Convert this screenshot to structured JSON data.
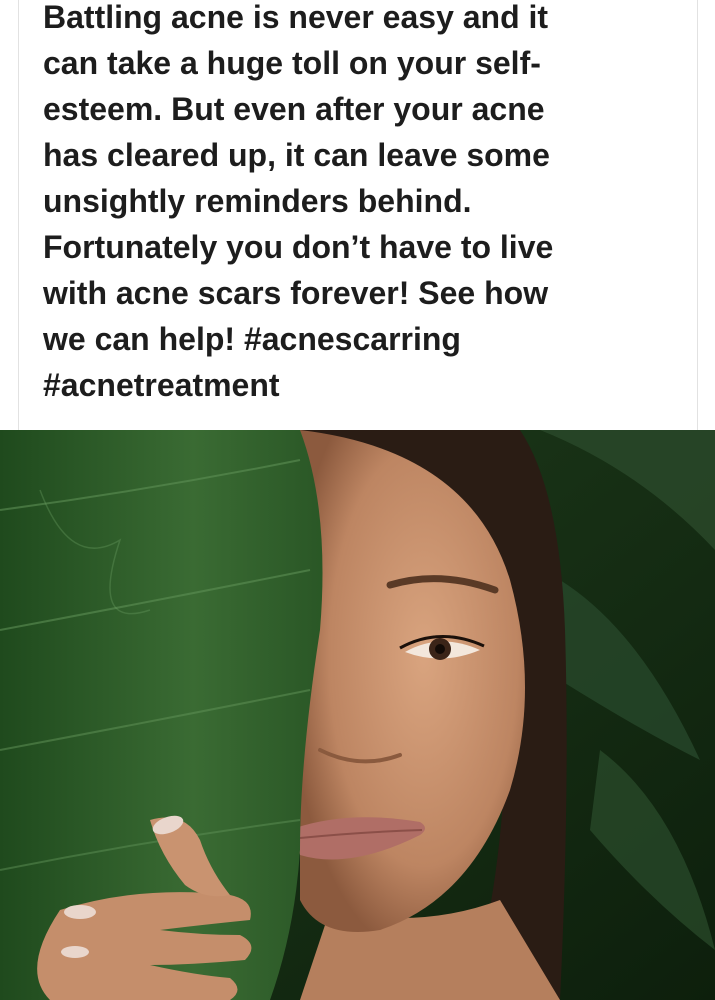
{
  "post": {
    "body": "Battling acne is never easy and it\ncan take a huge toll on your self-\nesteem. But even after your acne\nhas cleared up, it can leave some\nunsightly reminders behind.\nFortunately you don’t have to live\nwith acne scars forever! See how\nwe can help! ",
    "hashtags": [
      "#acnescarring",
      "#acnetreatment"
    ]
  },
  "image": {
    "subject": "woman-holding-green-leaf",
    "colors": {
      "leaf": "#2f5a2a",
      "background": "#1a3318",
      "skin": "#c89472",
      "lips": "#b06e66",
      "hair": "#2a1c14"
    }
  }
}
